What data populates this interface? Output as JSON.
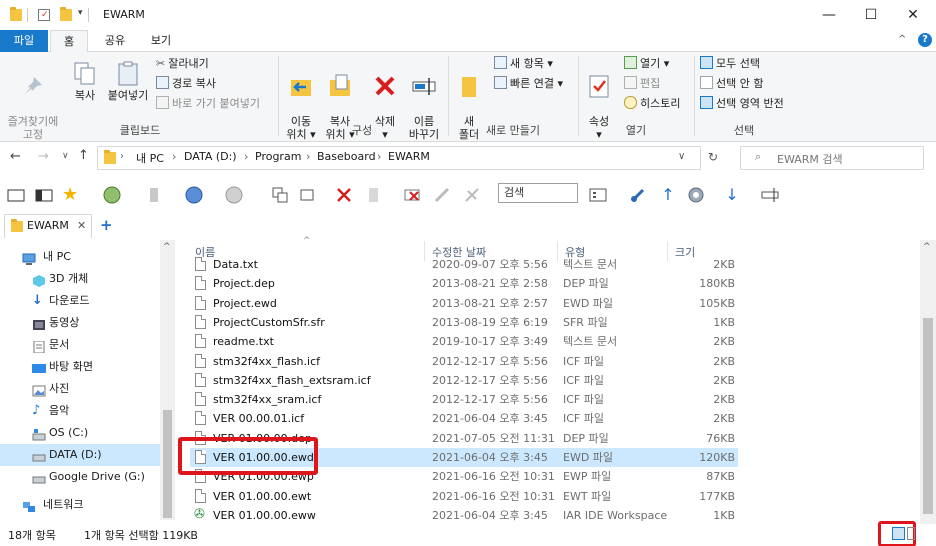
{
  "window": {
    "title": "EWARM",
    "minimize": "—",
    "maximize": "☐",
    "close": "✕"
  },
  "ribbon_tabs": [
    "파일",
    "홈",
    "공유",
    "보기"
  ],
  "ribbon": {
    "clipboard": {
      "pin_label": "즐겨찾기에\n고정",
      "copy_label": "복사",
      "paste_label": "붙여넣기",
      "cut": "잘라내기",
      "copy_path": "경로 복사",
      "paste_shortcut": "바로 가기 붙여넣기",
      "group": "클립보드"
    },
    "organize": {
      "move": "이동\n위치 ▾",
      "copy": "복사\n위치 ▾",
      "delete": "삭제\n▾",
      "rename": "이름\n바꾸기",
      "group": "구성"
    },
    "new": {
      "new_folder": "새\n폴더",
      "new_item": "새 항목 ▾",
      "easy_access": "빠른 연결 ▾",
      "group": "새로 만들기"
    },
    "open": {
      "properties": "속성\n▾",
      "open": "열기 ▾",
      "edit": "편집",
      "history": "히스토리",
      "group": "열기"
    },
    "select": {
      "select_all": "모두 선택",
      "select_none": "선택 안 함",
      "invert": "선택 영역 반전",
      "group": "선택"
    }
  },
  "address": {
    "crumbs": [
      "내 PC",
      "DATA (D:)",
      "Program",
      "Baseboard",
      "EWARM"
    ],
    "search_placeholder": "EWARM 검색"
  },
  "toolbar": {
    "search_placeholder": "검색"
  },
  "tab": {
    "label": "EWARM",
    "add": "+"
  },
  "nav": [
    {
      "label": "내 PC",
      "icon": "pc-icon"
    },
    {
      "label": "3D 개체",
      "icon": "3d-icon"
    },
    {
      "label": "다운로드",
      "icon": "download-icon"
    },
    {
      "label": "동영상",
      "icon": "video-icon"
    },
    {
      "label": "문서",
      "icon": "document-icon"
    },
    {
      "label": "바탕 화면",
      "icon": "desktop-icon"
    },
    {
      "label": "사진",
      "icon": "picture-icon"
    },
    {
      "label": "음악",
      "icon": "music-icon"
    },
    {
      "label": "OS (C:)",
      "icon": "drive-icon"
    },
    {
      "label": "DATA (D:)",
      "icon": "drive-icon"
    },
    {
      "label": "Google Drive (G:)",
      "icon": "drive-icon"
    },
    {
      "label": "네트워크",
      "icon": "network-icon"
    }
  ],
  "columns": {
    "name": "이름",
    "date": "수정한 날짜",
    "type": "유형",
    "size": "크기"
  },
  "files": [
    {
      "name": "Data.txt",
      "date": "2020-09-07 오후 5:56",
      "type": "텍스트 문서",
      "size": "2KB"
    },
    {
      "name": "Project.dep",
      "date": "2013-08-21 오후 2:58",
      "type": "DEP 파일",
      "size": "180KB"
    },
    {
      "name": "Project.ewd",
      "date": "2013-08-21 오후 2:57",
      "type": "EWD 파일",
      "size": "105KB"
    },
    {
      "name": "ProjectCustomSfr.sfr",
      "date": "2013-08-19 오후 6:19",
      "type": "SFR 파일",
      "size": "1KB"
    },
    {
      "name": "readme.txt",
      "date": "2019-10-17 오후 3:49",
      "type": "텍스트 문서",
      "size": "2KB"
    },
    {
      "name": "stm32f4xx_flash.icf",
      "date": "2012-12-17 오후 5:56",
      "type": "ICF 파일",
      "size": "2KB"
    },
    {
      "name": "stm32f4xx_flash_extsram.icf",
      "date": "2012-12-17 오후 5:56",
      "type": "ICF 파일",
      "size": "2KB"
    },
    {
      "name": "stm32f4xx_sram.icf",
      "date": "2012-12-17 오후 5:56",
      "type": "ICF 파일",
      "size": "2KB"
    },
    {
      "name": "VER 00.00.01.icf",
      "date": "2021-06-04 오후 3:45",
      "type": "ICF 파일",
      "size": "2KB"
    },
    {
      "name": "VER 01.00.00.dep",
      "date": "2021-07-05 오전 11:31",
      "type": "DEP 파일",
      "size": "76KB"
    },
    {
      "name": "VER 01.00.00.ewd",
      "date": "2021-06-04 오후 3:45",
      "type": "EWD 파일",
      "size": "120KB"
    },
    {
      "name": "VER 01.00.00.ewp",
      "date": "2021-06-16 오전 10:31",
      "type": "EWP 파일",
      "size": "87KB"
    },
    {
      "name": "VER 01.00.00.ewt",
      "date": "2021-06-16 오전 10:31",
      "type": "EWT 파일",
      "size": "177KB"
    },
    {
      "name": "VER 01.00.00.eww",
      "date": "2021-06-04 오후 3:45",
      "type": "IAR IDE Workspace",
      "size": "1KB"
    }
  ],
  "status": {
    "count": "18개 항목",
    "selected": "1개 항목 선택함 119KB"
  }
}
